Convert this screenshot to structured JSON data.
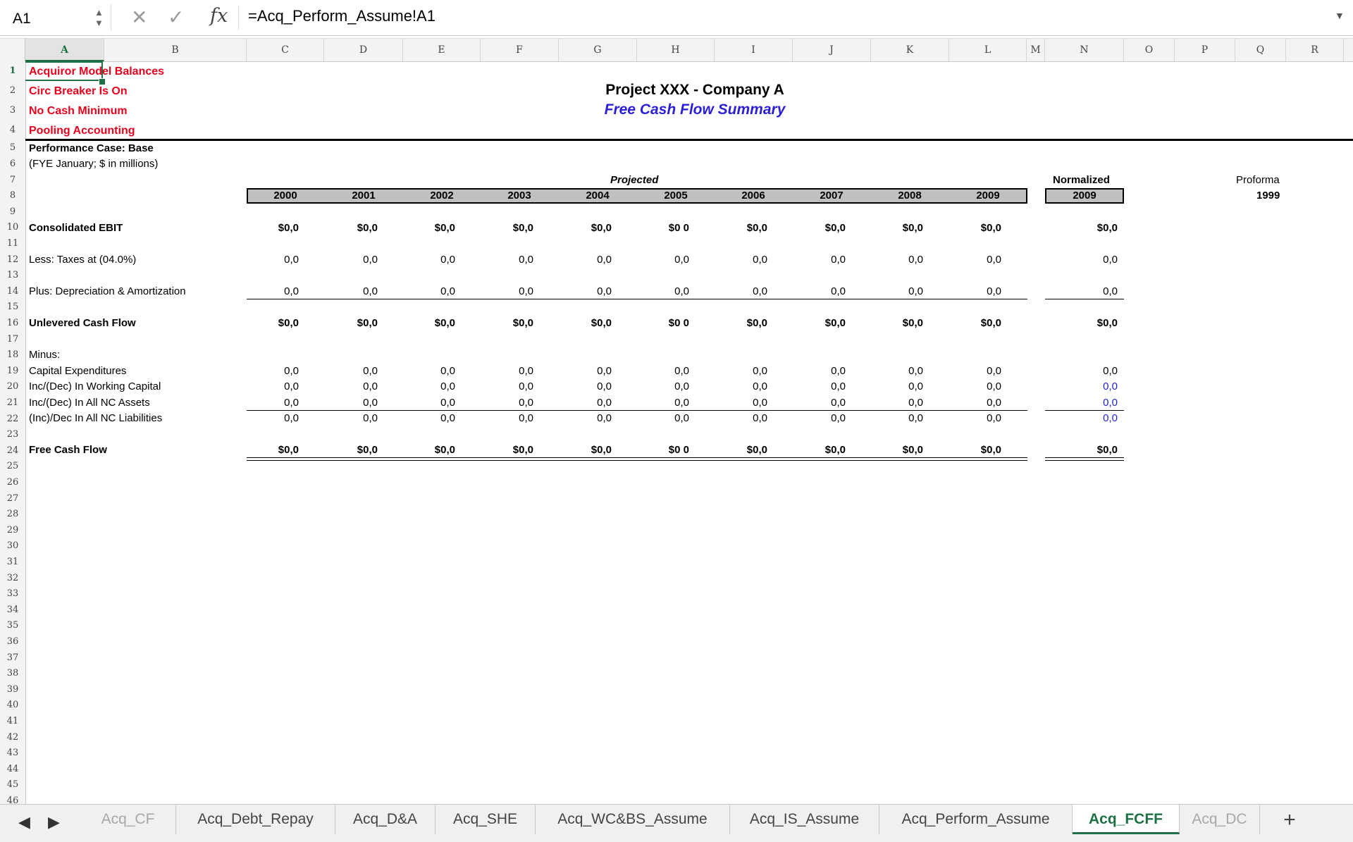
{
  "formula_bar": {
    "name_box": "A1",
    "formula": "=Acq_Perform_Assume!A1",
    "cancel_icon": "close-icon",
    "confirm_icon": "check-icon",
    "fx_label": "fx"
  },
  "columns": [
    "A",
    "B",
    "C",
    "D",
    "E",
    "F",
    "G",
    "H",
    "I",
    "J",
    "K",
    "L",
    "M",
    "N",
    "O",
    "P",
    "Q",
    "R"
  ],
  "rows": [
    "1",
    "2",
    "3",
    "4",
    "5",
    "6",
    "7",
    "8",
    "9",
    "10",
    "11",
    "12",
    "13",
    "14",
    "15",
    "16",
    "17",
    "18",
    "19",
    "20",
    "21",
    "22",
    "23",
    "24",
    "25",
    "26",
    "27",
    "28",
    "29",
    "30",
    "31",
    "32",
    "33",
    "34",
    "35",
    "36",
    "37",
    "38",
    "39",
    "40",
    "41",
    "42",
    "43",
    "44",
    "45",
    "46"
  ],
  "flags": [
    "Acquiror Model Balances",
    "Circ Breaker Is On",
    "No Cash Minimum",
    "Pooling Accounting"
  ],
  "title": "Project XXX - Company A",
  "subtitle": "Free Cash Flow Summary",
  "case_label": "Performance Case: Base",
  "fye_label": "(FYE January; $ in millions)",
  "projected_label": "Projected",
  "normalized_label": "Normalized",
  "proforma_label": "Proforma",
  "proforma_year": "1999",
  "years": [
    "2000",
    "2001",
    "2002",
    "2003",
    "2004",
    "2005",
    "2006",
    "2007",
    "2008",
    "2009"
  ],
  "normalized_year": "2009",
  "minus_label": "Minus:",
  "line_items": {
    "ebit": {
      "label": "Consolidated EBIT",
      "values": [
        "$0,0",
        "$0,0",
        "$0,0",
        "$0,0",
        "$0,0",
        "$0 0",
        "$0,0",
        "$0,0",
        "$0,0",
        "$0,0"
      ],
      "normalized": "$0,0"
    },
    "taxes": {
      "label": "Less: Taxes at (04.0%)",
      "values": [
        "0,0",
        "0,0",
        "0,0",
        "0,0",
        "0,0",
        "0,0",
        "0,0",
        "0,0",
        "0,0",
        "0,0"
      ],
      "normalized": "0,0"
    },
    "da": {
      "label": "Plus: Depreciation & Amortization",
      "values": [
        "0,0",
        "0,0",
        "0,0",
        "0,0",
        "0,0",
        "0,0",
        "0,0",
        "0,0",
        "0,0",
        "0,0"
      ],
      "normalized": "0,0"
    },
    "ucf": {
      "label": "Unlevered Cash Flow",
      "values": [
        "$0,0",
        "$0,0",
        "$0,0",
        "$0,0",
        "$0,0",
        "$0 0",
        "$0,0",
        "$0,0",
        "$0,0",
        "$0,0"
      ],
      "normalized": "$0,0"
    },
    "capex": {
      "label": "Capital Expenditures",
      "values": [
        "0,0",
        "0,0",
        "0,0",
        "0,0",
        "0,0",
        "0,0",
        "0,0",
        "0,0",
        "0,0",
        "0,0"
      ],
      "normalized": "0,0"
    },
    "wc": {
      "label": "Inc/(Dec) In Working Capital",
      "values": [
        "0,0",
        "0,0",
        "0,0",
        "0,0",
        "0,0",
        "0,0",
        "0,0",
        "0,0",
        "0,0",
        "0,0"
      ],
      "normalized": "0,0"
    },
    "nca": {
      "label": "Inc/(Dec) In All NC Assets",
      "values": [
        "0,0",
        "0,0",
        "0,0",
        "0,0",
        "0,0",
        "0,0",
        "0,0",
        "0,0",
        "0,0",
        "0,0"
      ],
      "normalized": "0,0"
    },
    "ncl": {
      "label": "(Inc)/Dec In All NC Liabilities",
      "values": [
        "0,0",
        "0,0",
        "0,0",
        "0,0",
        "0,0",
        "0,0",
        "0,0",
        "0,0",
        "0,0",
        "0,0"
      ],
      "normalized": "0,0"
    },
    "fcf": {
      "label": "Free Cash Flow",
      "values": [
        "$0,0",
        "$0,0",
        "$0,0",
        "$0,0",
        "$0,0",
        "$0 0",
        "$0,0",
        "$0,0",
        "$0,0",
        "$0,0"
      ],
      "normalized": "$0,0"
    }
  },
  "tabs": [
    "Acq_CF",
    "Acq_Debt_Repay",
    "Acq_D&A",
    "Acq_SHE",
    "Acq_WC&BS_Assume",
    "Acq_IS_Assume",
    "Acq_Perform_Assume",
    "Acq_FCFF",
    "Acq_DC"
  ],
  "active_tab": "Acq_FCFF",
  "add_sheet_label": "+",
  "colors": {
    "accent": "#1e7145",
    "flag_red": "#e8001c",
    "subtitle_blue": "#2a1fd6",
    "link_blue": "#1f1fd8",
    "band_gray": "#c0c0c0"
  }
}
